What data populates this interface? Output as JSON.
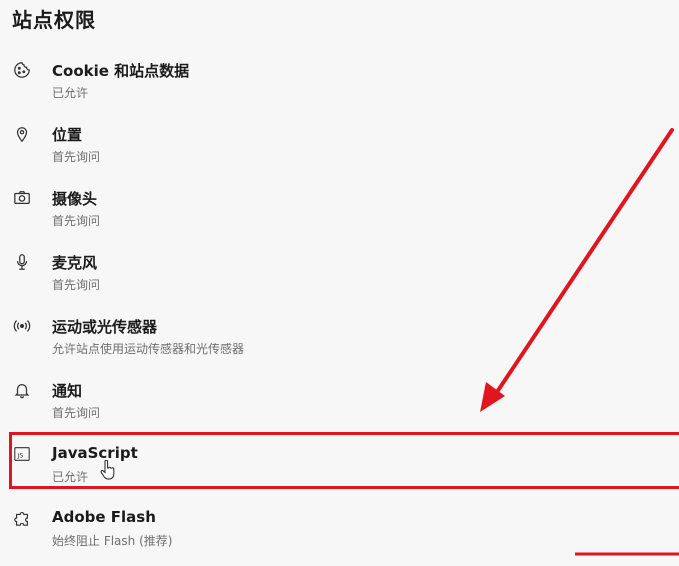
{
  "page": {
    "title": "站点权限"
  },
  "permissions": [
    {
      "id": "cookie",
      "icon": "cookie-icon",
      "title": "Cookie 和站点数据",
      "status": "已允许"
    },
    {
      "id": "location",
      "icon": "location-pin-icon",
      "title": "位置",
      "status": "首先询问"
    },
    {
      "id": "camera",
      "icon": "camera-icon",
      "title": "摄像头",
      "status": "首先询问"
    },
    {
      "id": "microphone",
      "icon": "microphone-icon",
      "title": "麦克风",
      "status": "首先询问"
    },
    {
      "id": "motion",
      "icon": "broadcast-icon",
      "title": "运动或光传感器",
      "status": "允许站点使用运动传感器和光传感器"
    },
    {
      "id": "notifications",
      "icon": "bell-icon",
      "title": "通知",
      "status": "首先询问"
    },
    {
      "id": "javascript",
      "icon": "js-file-icon",
      "title": "JavaScript",
      "status": "已允许"
    },
    {
      "id": "flash",
      "icon": "puzzle-piece-icon",
      "title": "Adobe Flash",
      "status": "始终阻止 Flash (推荐)"
    }
  ],
  "annotation": {
    "color": "#e0161f",
    "highlighted": "javascript"
  }
}
